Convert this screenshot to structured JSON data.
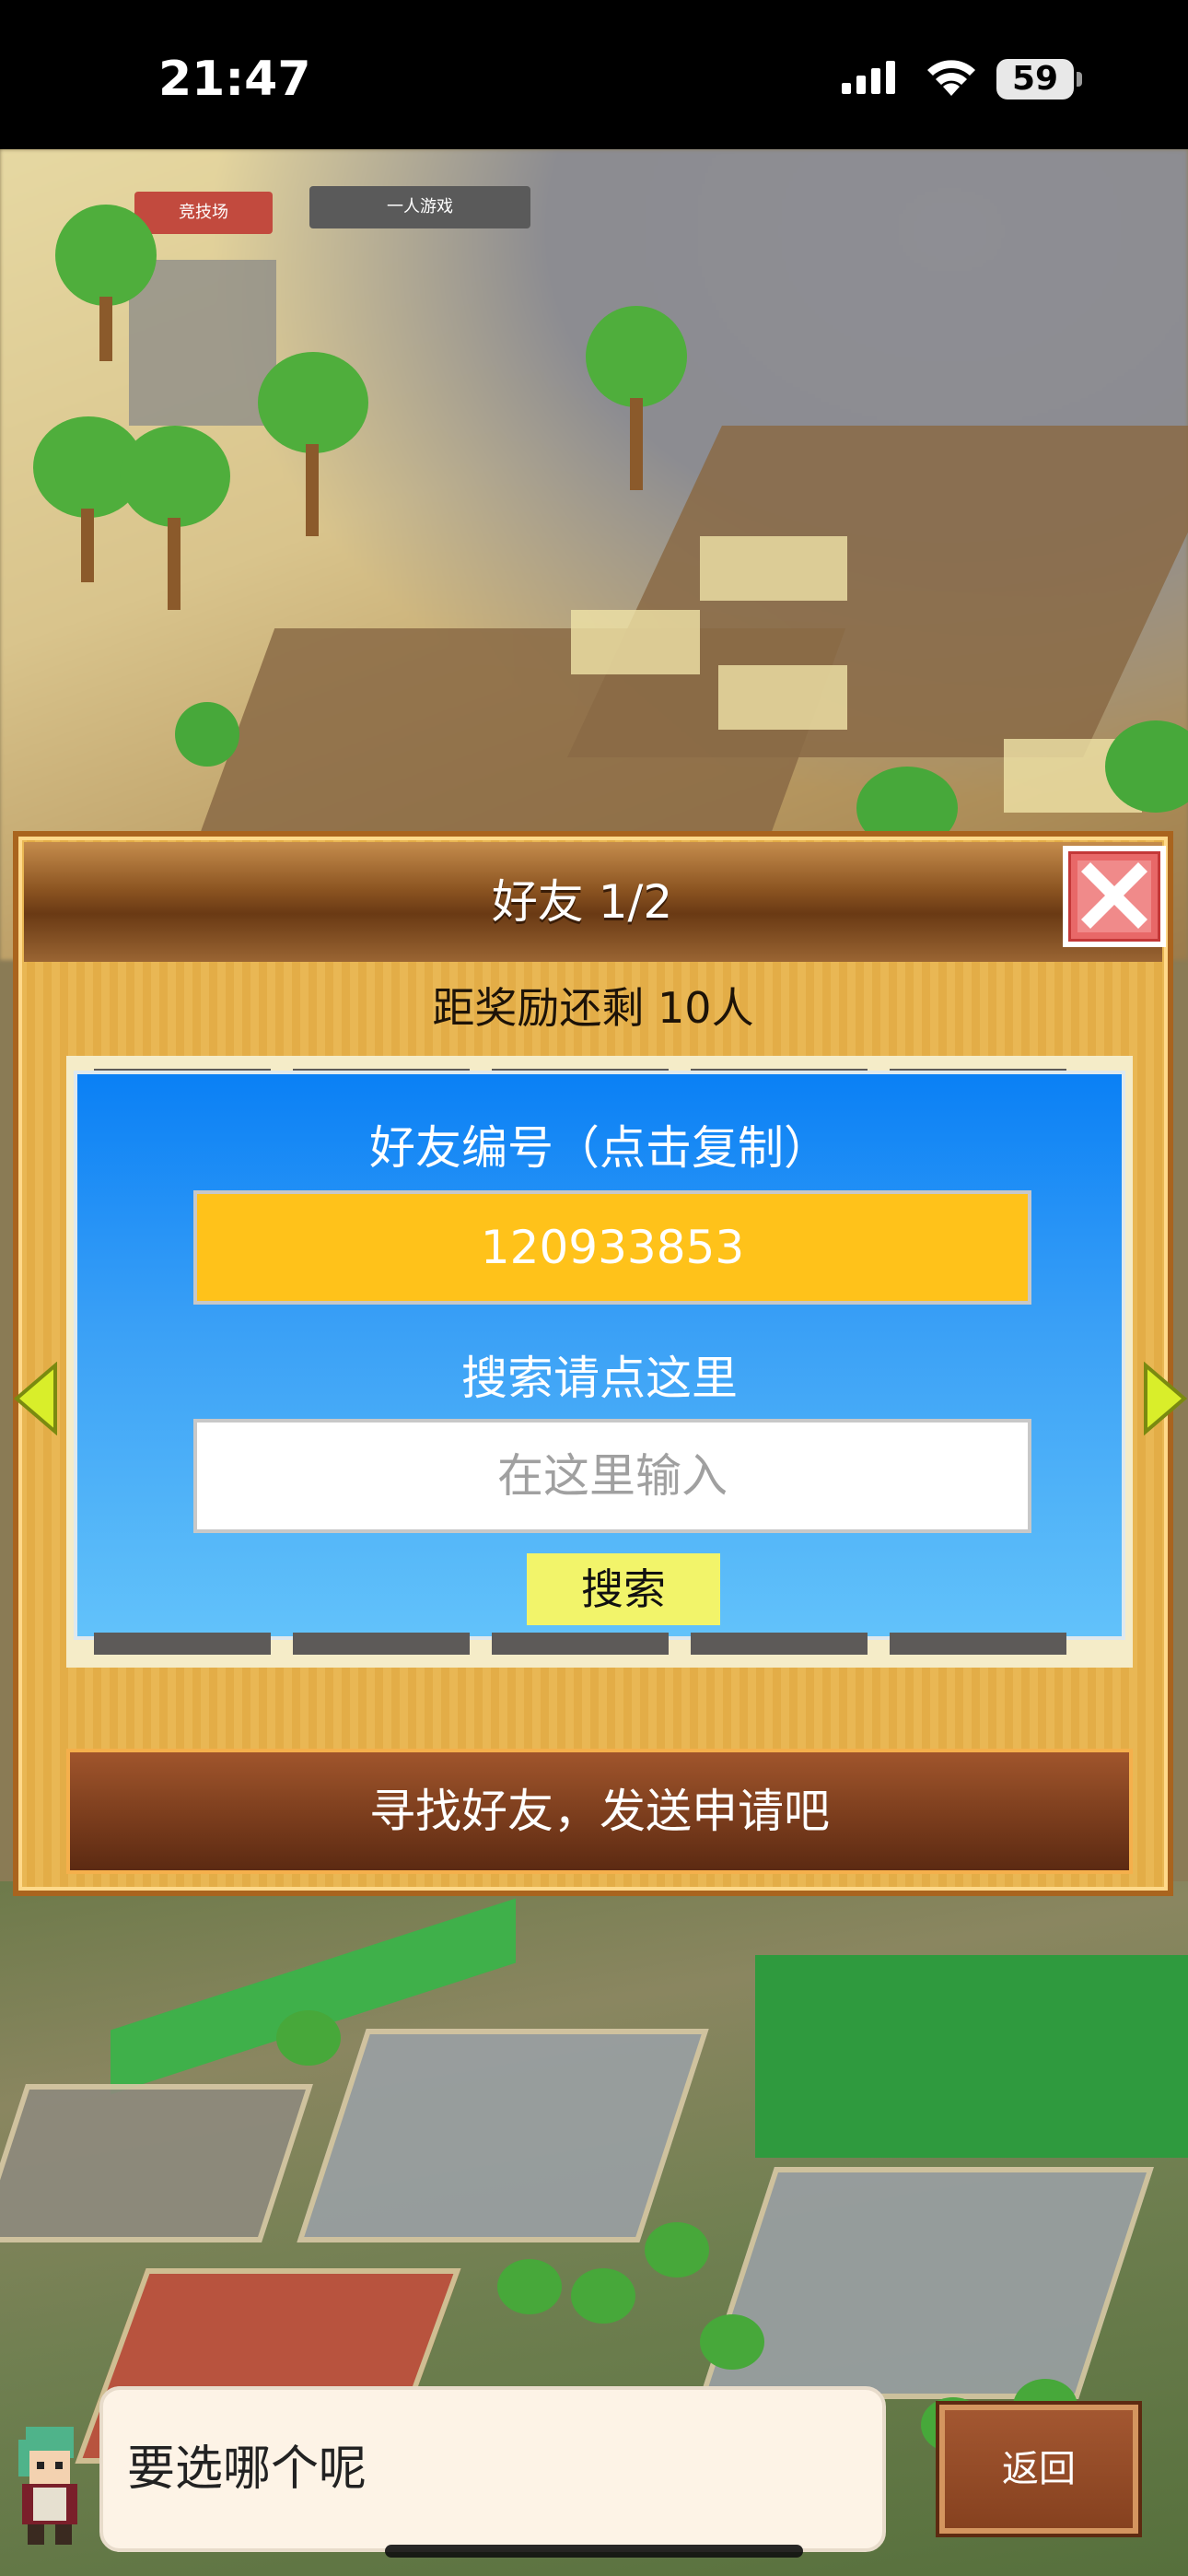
{
  "status_bar": {
    "time": "21:47",
    "battery_level": "59",
    "icons": [
      "signal-icon",
      "wifi-icon",
      "battery-icon"
    ]
  },
  "map": {
    "labels": [
      "竞技场",
      "一人游戏"
    ]
  },
  "dialog": {
    "title": "好友 1/2",
    "reward_text": "距奖励还剩 10人",
    "friend_id_label": "好友编号（点击复制）",
    "friend_id_value": "120933853",
    "search_hint": "搜索请点这里",
    "search_placeholder": "在这里输入",
    "search_button": "搜索",
    "find_friends_text": "寻找好友，发送申请吧"
  },
  "bottom_bar": {
    "speech_text": "要选哪个呢",
    "back_button": "返回"
  },
  "colors": {
    "panel_blue": "#0a80f5",
    "friend_id_bg": "#ffc21a",
    "search_button_bg": "#f2f46a",
    "dialog_wood": "#e9b754",
    "header_brown": "#6a3a14",
    "close_red": "#e86868"
  }
}
